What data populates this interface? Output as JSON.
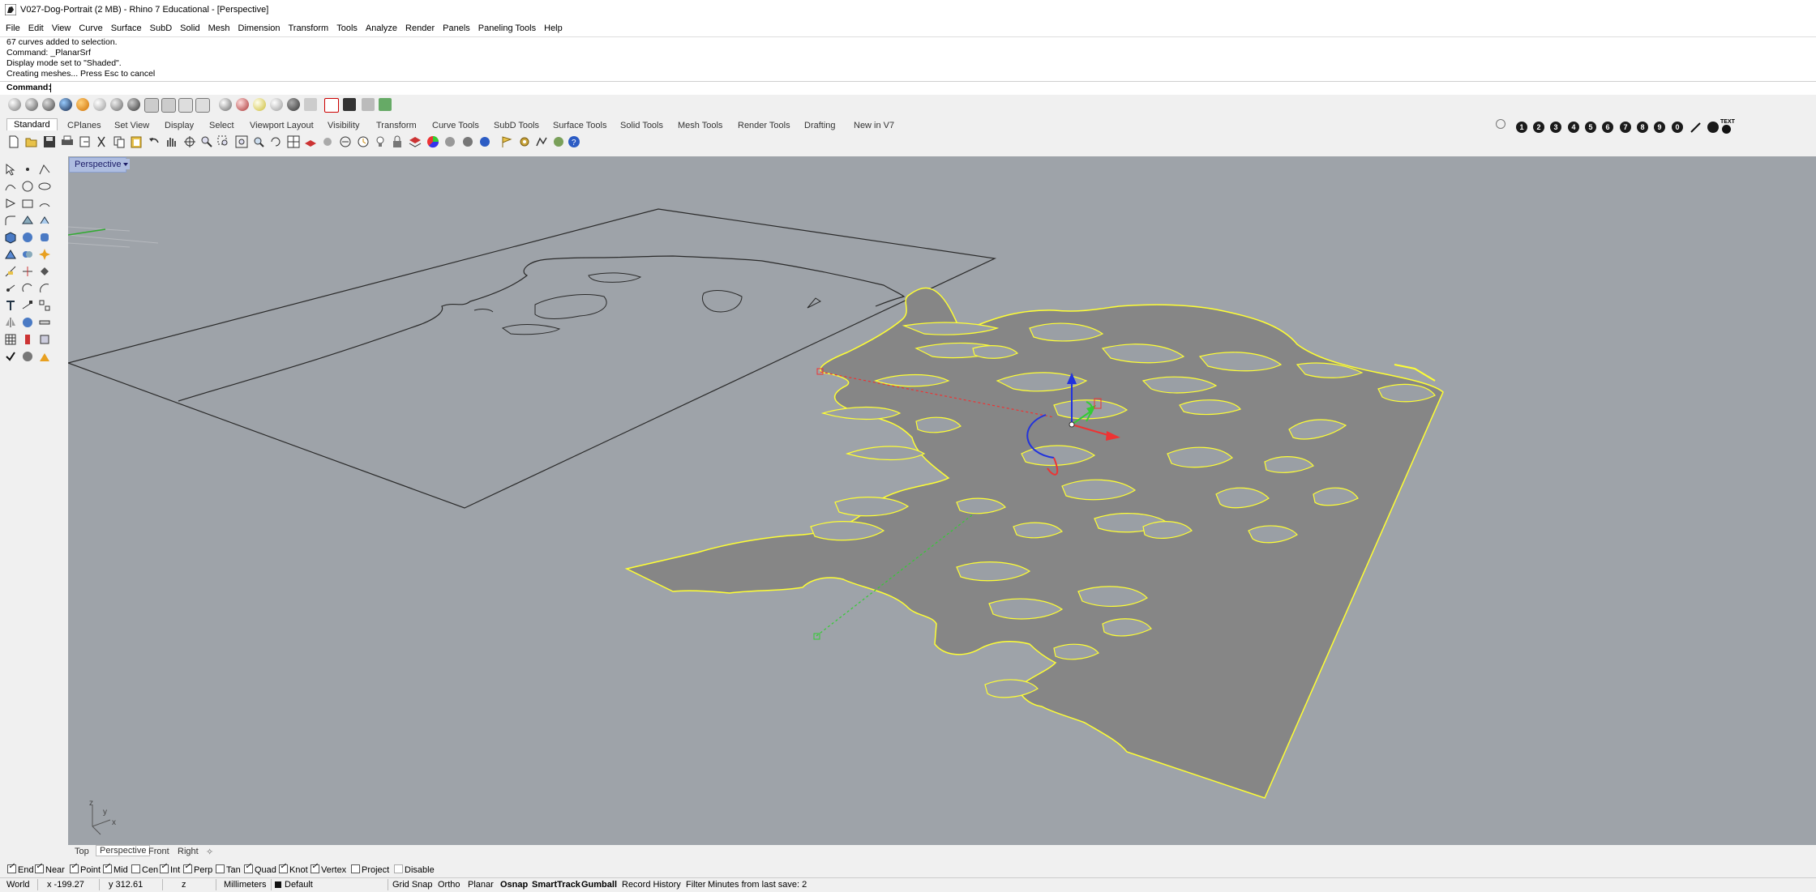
{
  "window": {
    "title": "V027-Dog-Portrait (2 MB) - Rhino 7 Educational - [Perspective]"
  },
  "menu": [
    "File",
    "Edit",
    "View",
    "Curve",
    "Surface",
    "SubD",
    "Solid",
    "Mesh",
    "Dimension",
    "Transform",
    "Tools",
    "Analyze",
    "Render",
    "Panels",
    "Paneling Tools",
    "Help"
  ],
  "command_history": [
    "67 curves added to selection.",
    "Command: _PlanarSrf",
    "Display mode set to \"Shaded\".",
    "Creating meshes... Press Esc to cancel"
  ],
  "command_prompt": {
    "label": "Command:",
    "value": ""
  },
  "toolbar_tabs": [
    "Standard",
    "CPlanes",
    "Set View",
    "Display",
    "Select",
    "Viewport Layout",
    "Visibility",
    "Transform",
    "Curve Tools",
    "SubD Tools",
    "Surface Tools",
    "Solid Tools",
    "Mesh Tools",
    "Render Tools",
    "Drafting",
    "New in V7"
  ],
  "right_buttons": [
    "1",
    "2",
    "3",
    "4",
    "5",
    "6",
    "7",
    "8",
    "9",
    "0"
  ],
  "right_text_button": "TEXT",
  "viewport": {
    "label": "Perspective"
  },
  "viewport_tabs": [
    "Top",
    "Perspective",
    "Front",
    "Right"
  ],
  "osnaps": [
    {
      "label": "End",
      "on": true
    },
    {
      "label": "Near",
      "on": true
    },
    {
      "label": "Point",
      "on": true
    },
    {
      "label": "Mid",
      "on": true
    },
    {
      "label": "Cen",
      "on": false
    },
    {
      "label": "Int",
      "on": true
    },
    {
      "label": "Perp",
      "on": true
    },
    {
      "label": "Tan",
      "on": false
    },
    {
      "label": "Quad",
      "on": true
    },
    {
      "label": "Knot",
      "on": true
    },
    {
      "label": "Vertex",
      "on": true
    },
    {
      "label": "Project",
      "on": false
    },
    {
      "label": "Disable",
      "on": false
    }
  ],
  "status": {
    "cplane": "World",
    "x": "x -199.27",
    "y": "y 312.61",
    "z": "z",
    "units": "Millimeters",
    "layer": "Default",
    "toggles": [
      "Grid Snap",
      "Ortho",
      "Planar",
      "Osnap",
      "SmartTrack",
      "Gumball",
      "Record History",
      "Filter"
    ],
    "save_info": "Minutes from last save: 2"
  },
  "colors": {
    "viewport_bg": "#9ea3a9",
    "selection": "#ffff33",
    "surface": "#868686"
  }
}
